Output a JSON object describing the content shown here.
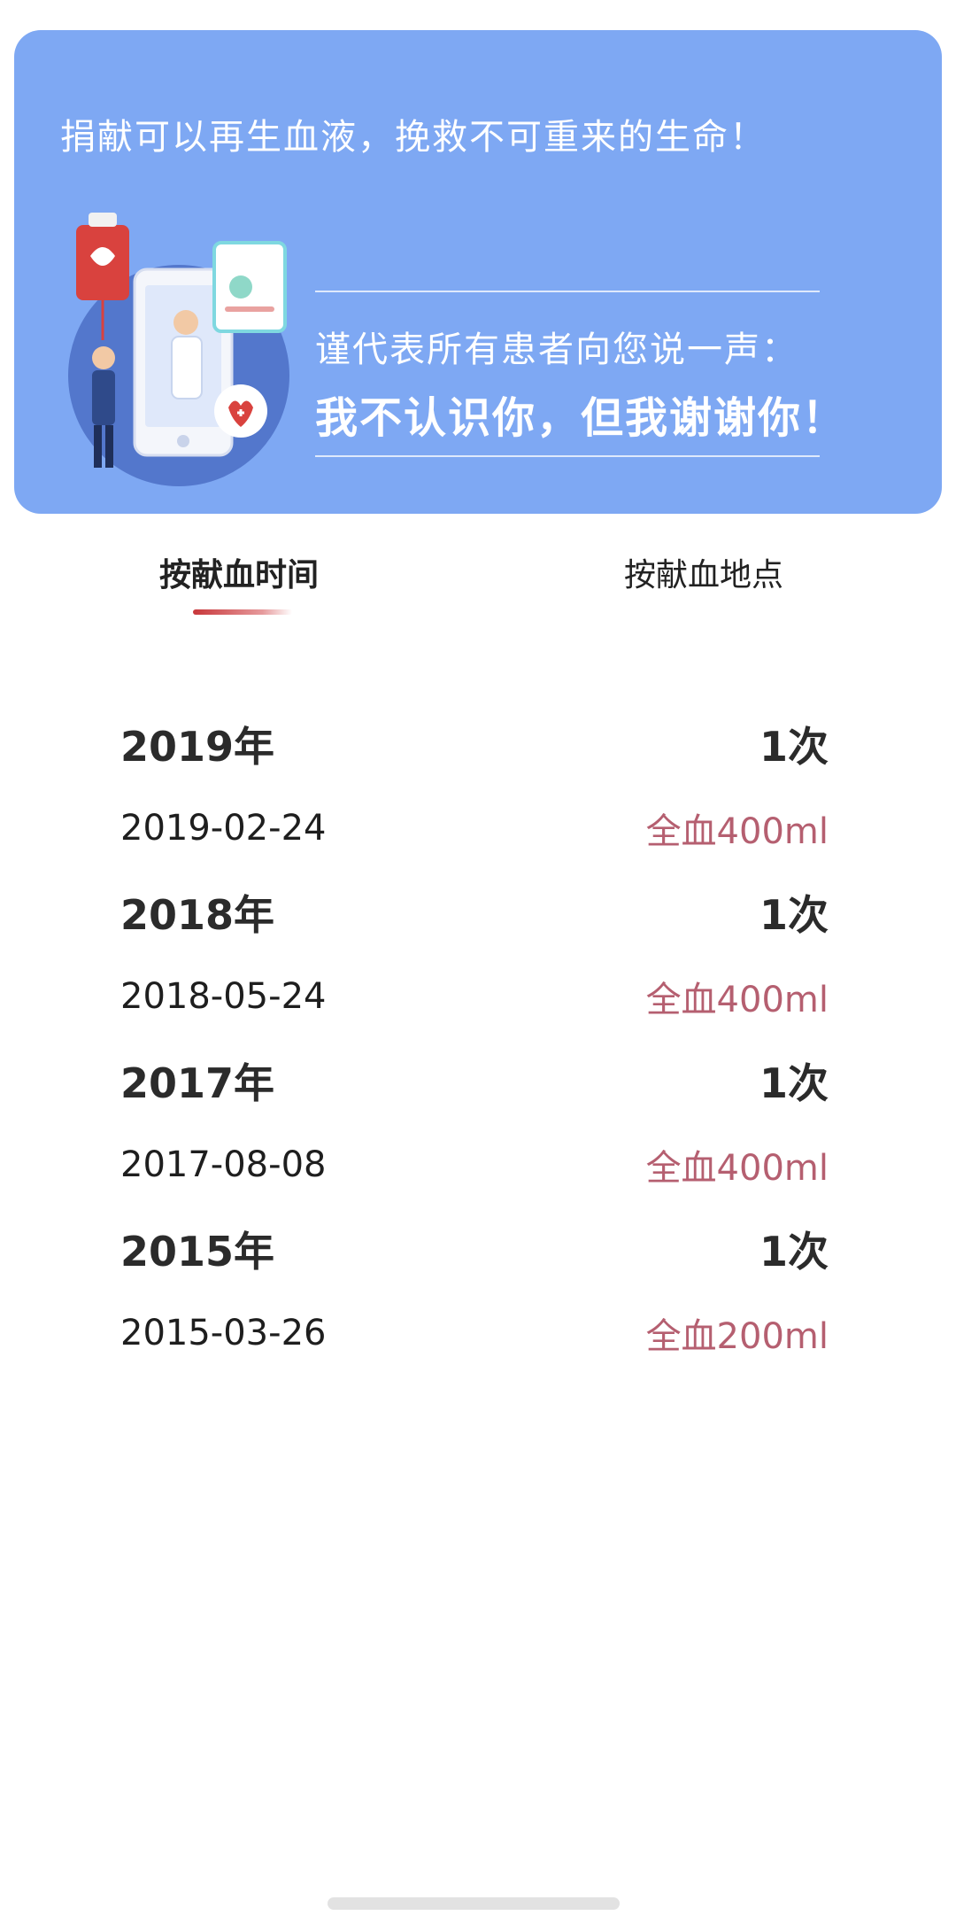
{
  "banner": {
    "slogan": "捐献可以再生血液，挽救不可重来的生命！",
    "thanks_sub": "谨代表所有患者向您说一声：",
    "thanks_main": "我不认识你，但我谢谢你！"
  },
  "tabs": [
    {
      "label": "按献血时间",
      "active": true
    },
    {
      "label": "按献血地点",
      "active": false
    }
  ],
  "records": [
    {
      "year": "2019年",
      "count": "1次",
      "date": "2019-02-24",
      "amount": "全血400ml"
    },
    {
      "year": "2018年",
      "count": "1次",
      "date": "2018-05-24",
      "amount": "全血400ml"
    },
    {
      "year": "2017年",
      "count": "1次",
      "date": "2017-08-08",
      "amount": "全血400ml"
    },
    {
      "year": "2015年",
      "count": "1次",
      "date": "2015-03-26",
      "amount": "全血200ml"
    }
  ],
  "colors": {
    "banner_bg": "#7ea8f3",
    "accent_red": "#c8373a",
    "amount_text": "#b55f70"
  }
}
